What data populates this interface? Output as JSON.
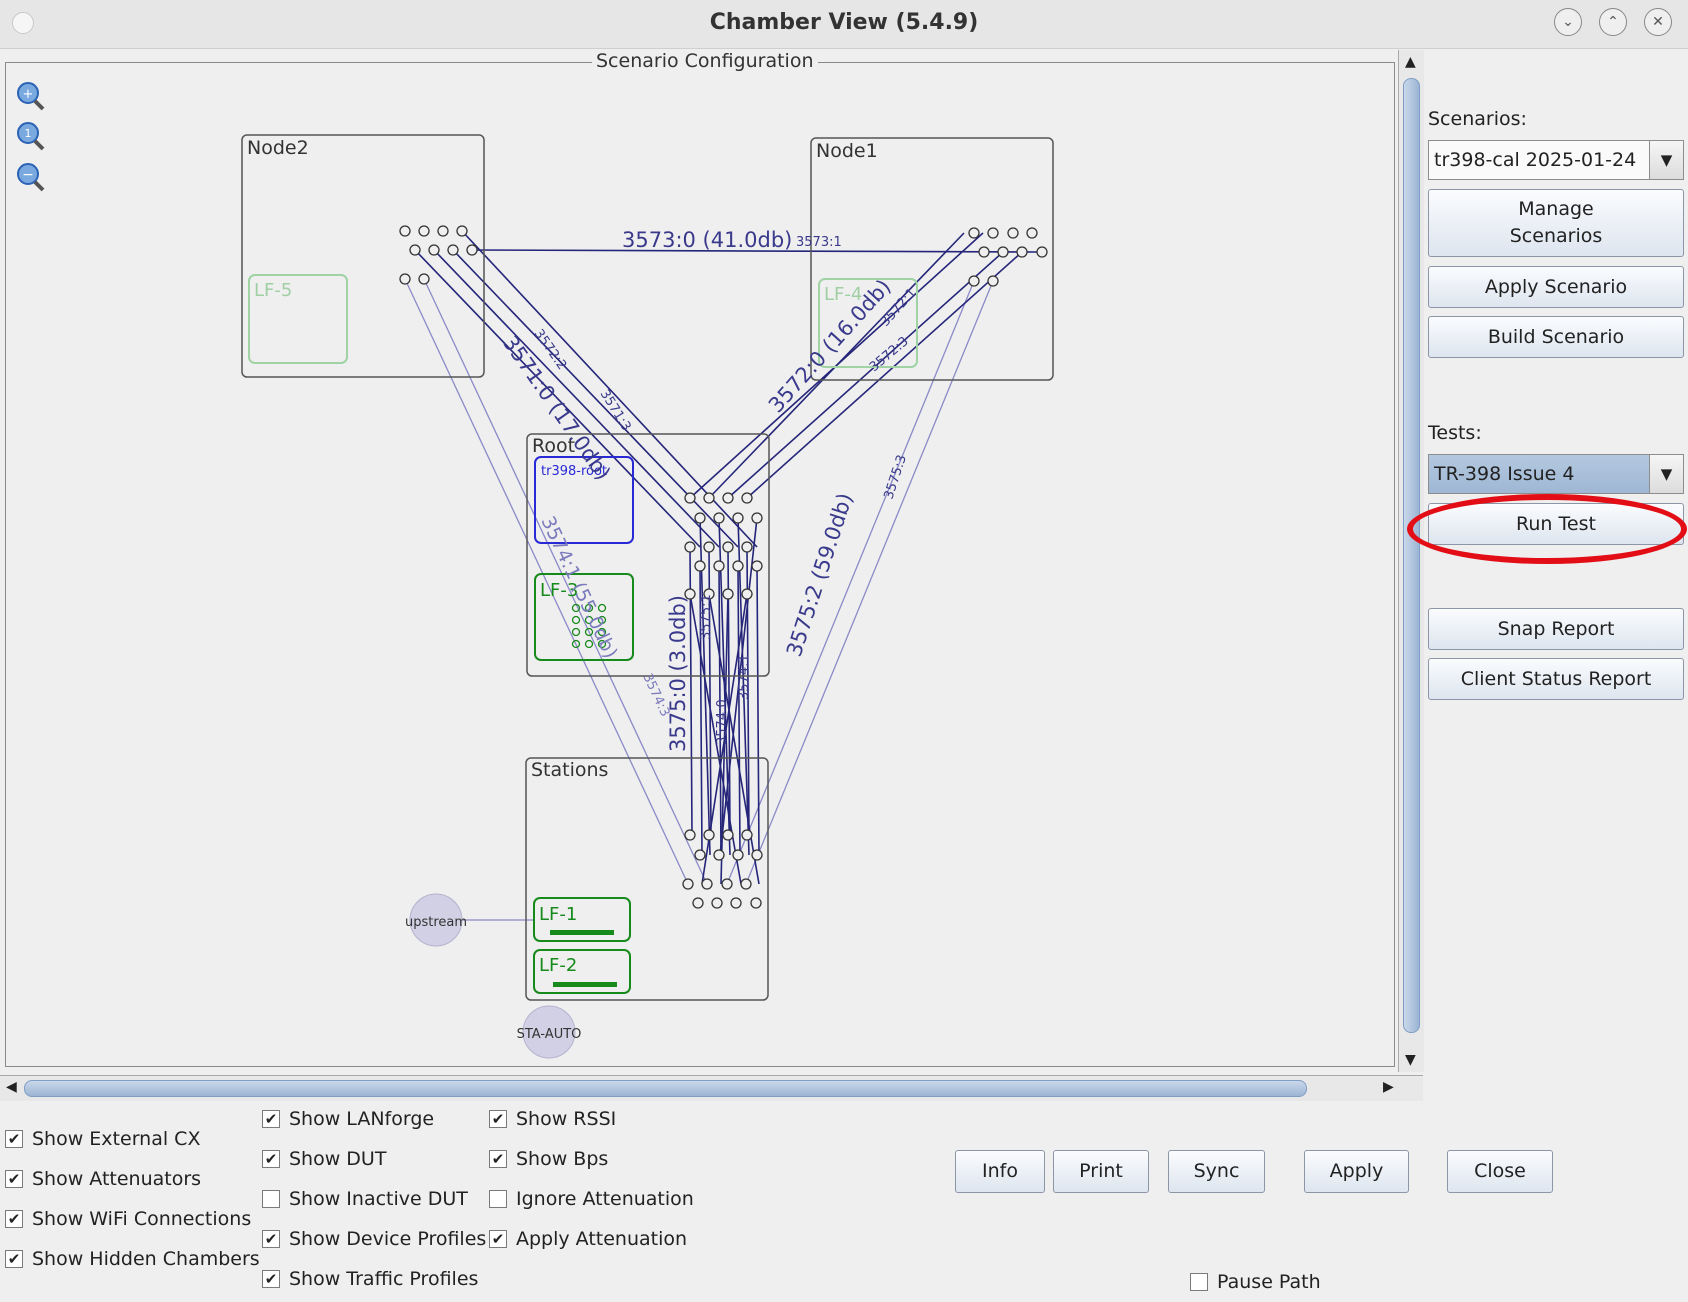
{
  "window": {
    "title": "Chamber View (5.4.9)"
  },
  "scenario_panel": {
    "legend": "Scenario Configuration"
  },
  "chambers": {
    "node2": "Node2",
    "node1": "Node1",
    "root": "Root",
    "stations": "Stations",
    "lf5": "LF-5",
    "lf4": "LF-4",
    "dut": "tr398-root",
    "lf3": "LF-3",
    "lf1": "LF-1",
    "lf2": "LF-2",
    "upstream": "upstream",
    "sta_auto": "STA-AUTO"
  },
  "links": {
    "l1": "3573:0 (41.0db)",
    "l2": "3573:1",
    "l3": "3572:2",
    "l4": "3571:3",
    "l5": "3571:0 (17.0db)",
    "l6": "3572:0 (16.0db)",
    "l7": "3572:1",
    "l8": "3572:3",
    "l9": "3575:3",
    "l10": "3575:2 (59.0db)",
    "l11": "3574:1 (55.0db)",
    "l12": "3575:0 (3.0db)",
    "l13": "3574:3",
    "l14": "3575:1",
    "l15": "3574:0",
    "l16": "3574:1"
  },
  "sidebar": {
    "scenarios_label": "Scenarios:",
    "scenario_value": "tr398-cal 2025-01-24",
    "manage_line1": "Manage",
    "manage_line2": "Scenarios",
    "apply_scenario": "Apply Scenario",
    "build_scenario": "Build Scenario",
    "tests_label": "Tests:",
    "test_value": "TR-398 Issue 4",
    "run_test": "Run Test",
    "snap_report": "Snap Report",
    "client_status_report": "Client Status Report"
  },
  "checkboxes": [
    {
      "label": "Show External CX",
      "checked": true
    },
    {
      "label": "Show Attenuators",
      "checked": true
    },
    {
      "label": "Show WiFi Connections",
      "checked": true
    },
    {
      "label": "Show Hidden Chambers",
      "checked": true
    },
    {
      "label": "Show LANforge",
      "checked": true
    },
    {
      "label": "Show DUT",
      "checked": true
    },
    {
      "label": "Show Inactive DUT",
      "checked": false
    },
    {
      "label": "Show Device Profiles",
      "checked": true
    },
    {
      "label": "Show Traffic Profiles",
      "checked": true
    },
    {
      "label": "Show RSSI",
      "checked": true
    },
    {
      "label": "Show Bps",
      "checked": true
    },
    {
      "label": "Ignore Attenuation",
      "checked": false
    },
    {
      "label": "Apply Attenuation",
      "checked": true
    },
    {
      "label": "Pause Path",
      "checked": false
    }
  ],
  "buttons": {
    "info": "Info",
    "print": "Print",
    "sync": "Sync",
    "apply": "Apply",
    "close": "Close"
  },
  "icons": [
    "zoom-in-icon",
    "zoom-reset-icon",
    "zoom-out-icon",
    "collapse-icon",
    "maximize-icon",
    "close-icon"
  ]
}
